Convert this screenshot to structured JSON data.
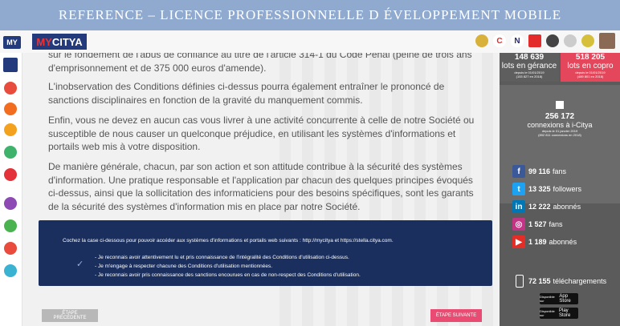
{
  "banner": {
    "title": "REFERENCE – LICENCE PROFESSIONNELLE D ÉVELOPPEMENT MOBILE"
  },
  "brand": {
    "small": "MY",
    "main_a": "MY",
    "main_b": "CITYA"
  },
  "topbar": {
    "icons": [
      {
        "name": "cat-icon",
        "color": "#d8b13a",
        "text": ""
      },
      {
        "name": "c-icon",
        "color": "#fff",
        "text": "C"
      },
      {
        "name": "n-icon",
        "color": "#fff",
        "text": "N"
      },
      {
        "name": "bookmark-icon",
        "color": "#e32b2b",
        "text": ""
      },
      {
        "name": "film-icon",
        "color": "#444",
        "text": ""
      },
      {
        "name": "dial-icon",
        "color": "#ddd",
        "text": ""
      },
      {
        "name": "pencil-icon",
        "color": "#d6c03b",
        "text": ""
      }
    ]
  },
  "sidebar": {
    "icon_colors": [
      "#e84c3d",
      "#f36d21",
      "#f4a21d",
      "#3fb36b",
      "#e4323b",
      "#8d4ab5",
      "#4ab34f",
      "#e94b3d",
      "#3ab3d3"
    ]
  },
  "content": {
    "para0": "sur le fondement de l'abus de confiance au titre de l'article 314-1 du Code Pénal (peine de trois ans",
    "para0b": "d'emprisonnement et de 375 000 euros d'amende).",
    "para1": "L'inobservation des Conditions définies ci-dessus pourra également entraîner le prononcé de sanctions disciplinaires en fonction de la gravité du manquement commis.",
    "para2": "Enfin, vous ne devez en aucun cas vous livrer à une activité concurrente à celle de notre Société ou susceptible de nous causer un quelconque préjudice, en utilisant les systèmes d'informations et portails web mis à votre disposition.",
    "para3": "De manière générale, chacun, par son action et son attitude contribue à la sécurité des systèmes d'information. Une pratique responsable et l'application par chacun des quelques principes évoqués ci-dessus, ainsi que la sollicitation des informaticiens pour des besoins spécifiques, sont les garants de la sécurité des systèmes d'information mis en place par notre Société."
  },
  "panel": {
    "intro": "Cochez la case ci-dessous pour pouvoir accéder aux systèmes d'informations et portails web suivants : http://mycitya et https://stella.citya.com.",
    "check": "✓",
    "items": [
      "- Je reconnais avoir attentivement lu et pris connaissance de l'intégralité des Conditions d'utilisation ci-dessus.",
      "- Je m'engage à respecter chacune des Conditions d'utilisation mentionnées.",
      "- Je reconnais avoir pris connaissance des sanctions encourues en cas de non-respect des Conditions d'utilisation."
    ]
  },
  "buttons": {
    "prev": "ÉTAPE PRÉCÉDENTE",
    "next": "ÉTAPE SUIVANTE"
  },
  "stats": {
    "gerance": {
      "value": "148 639",
      "label": "lots en gérance",
      "note1": "depuis le 01/01/2019",
      "note2": "(153 827 en 2018)"
    },
    "copro": {
      "value": "518 205",
      "label": "lots en copro",
      "note1": "depuis le 01/01/2019",
      "note2": "(489 801 en 2018)"
    },
    "connexions": {
      "value": "256 172",
      "label": "connexions à i-Citya",
      "note1": "depuis le 01 janvier 2019",
      "note2": "(892 811 connexions en 2018)"
    }
  },
  "social": [
    {
      "network": "facebook",
      "count": "99 116",
      "label": "fans",
      "color": "#3b5998",
      "icon": "f"
    },
    {
      "network": "twitter",
      "count": "13 325",
      "label": "followers",
      "color": "#1da1f2",
      "icon": "t"
    },
    {
      "network": "linkedin",
      "count": "12 222",
      "label": "abonnés",
      "color": "#0077b5",
      "icon": "in"
    },
    {
      "network": "instagram",
      "count": "1 527",
      "label": "fans",
      "color": "#c13584",
      "icon": "◎"
    },
    {
      "network": "youtube",
      "count": "1 189",
      "label": "abonnés",
      "color": "#e52d27",
      "icon": "▶"
    }
  ],
  "downloads": {
    "count": "72 155",
    "label": "téléchargements",
    "appstore": "App Store",
    "appstore_pre": "Disponible sur",
    "playstore": "Play Store",
    "playstore_pre": "Disponible sur"
  },
  "colors": {
    "accent": "#e94b72",
    "navy": "#1a2f5e",
    "brand": "#233a7d"
  }
}
